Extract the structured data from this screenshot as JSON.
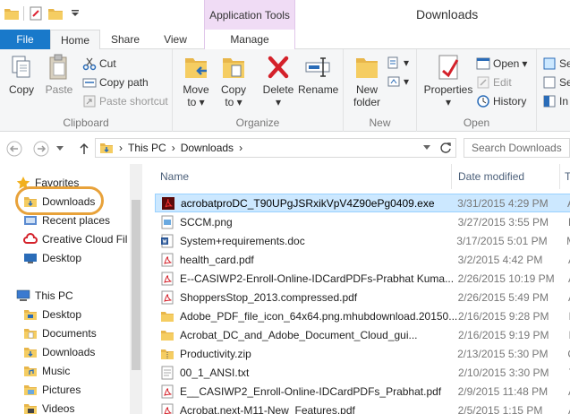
{
  "window": {
    "title": "Downloads",
    "context_tab_header": "Application Tools"
  },
  "tabs": {
    "file": "File",
    "home": "Home",
    "share": "Share",
    "view": "View",
    "manage": "Manage"
  },
  "ribbon": {
    "clipboard": {
      "label": "Clipboard",
      "copy": "Copy",
      "paste": "Paste",
      "cut": "Cut",
      "copy_path": "Copy path",
      "paste_shortcut": "Paste shortcut"
    },
    "organize": {
      "label": "Organize",
      "move_to_1": "Move",
      "move_to_2": "to",
      "copy_to_1": "Copy",
      "copy_to_2": "to",
      "delete": "Delete",
      "rename": "Rename"
    },
    "new": {
      "label": "New",
      "new_folder_1": "New",
      "new_folder_2": "folder"
    },
    "open": {
      "label": "Open",
      "properties": "Properties",
      "open": "Open",
      "edit": "Edit",
      "history": "History"
    },
    "select_partial_1": "Se",
    "select_partial_2": "Se",
    "select_partial_3": "In"
  },
  "address": {
    "this_pc": "This PC",
    "downloads": "Downloads",
    "search_placeholder": "Search Downloads"
  },
  "nav": {
    "favorites": "Favorites",
    "downloads": "Downloads",
    "recent_places": "Recent places",
    "creative_cloud": "Creative Cloud Fil",
    "desktop": "Desktop",
    "this_pc": "This PC",
    "pc_desktop": "Desktop",
    "pc_documents": "Documents",
    "pc_downloads": "Downloads",
    "pc_music": "Music",
    "pc_pictures": "Pictures",
    "pc_videos": "Videos"
  },
  "columns": {
    "name": "Name",
    "date": "Date modified",
    "type_partial": "T"
  },
  "files": [
    {
      "name": "acrobatproDC_T90UPgJSRxikVpV4Z90ePg0409.exe",
      "date": "3/31/2015 4:29 PM",
      "type": "A",
      "icon": "adobe-exe-icon"
    },
    {
      "name": "SCCM.png",
      "date": "3/27/2015 3:55 PM",
      "type": "P",
      "icon": "image-file-icon"
    },
    {
      "name": "System+requirements.doc",
      "date": "3/17/2015 5:01 PM",
      "type": "M",
      "icon": "word-doc-icon"
    },
    {
      "name": "health_card.pdf",
      "date": "3/2/2015 4:42 PM",
      "type": "A",
      "icon": "pdf-file-icon"
    },
    {
      "name": "E--CASIWP2-Enroll-Online-IDCardPDFs-Prabhat Kuma...",
      "date": "2/26/2015 10:19 PM",
      "type": "A",
      "icon": "pdf-file-icon"
    },
    {
      "name": "ShoppersStop_2013.compressed.pdf",
      "date": "2/26/2015 5:49 PM",
      "type": "A",
      "icon": "pdf-file-icon"
    },
    {
      "name": "Adobe_PDF_file_icon_64x64.png.mhubdownload.20150...",
      "date": "2/16/2015 9:28 PM",
      "type": "F",
      "icon": "folder-icon"
    },
    {
      "name": "Acrobat_DC_and_Adobe_Document_Cloud_gui...",
      "date": "2/16/2015 9:19 PM",
      "type": "F",
      "icon": "folder-icon"
    },
    {
      "name": "Productivity.zip",
      "date": "2/13/2015 5:30 PM",
      "type": "C",
      "icon": "zip-file-icon"
    },
    {
      "name": "00_1_ANSI.txt",
      "date": "2/10/2015 3:30 PM",
      "type": "T",
      "icon": "text-file-icon"
    },
    {
      "name": "E__CASIWP2_Enroll-Online-IDCardPDFs_Prabhat.pdf",
      "date": "2/9/2015 11:48 PM",
      "type": "A",
      "icon": "pdf-file-icon"
    },
    {
      "name": "Acrobat.next-M11-New_Features.pdf",
      "date": "2/5/2015 1:15 PM",
      "type": "A",
      "icon": "pdf-file-icon"
    }
  ]
}
